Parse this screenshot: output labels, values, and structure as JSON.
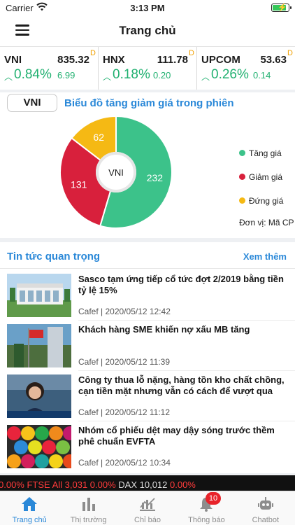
{
  "status_bar": {
    "carrier": "Carrier",
    "time": "3:13 PM",
    "battery_level": 0.9
  },
  "header": {
    "title": "Trang chủ"
  },
  "tickers": [
    {
      "name": "VNI",
      "value": "835.32",
      "mark": "D",
      "change_pct": "0.84%",
      "change": "6.99"
    },
    {
      "name": "HNX",
      "value": "111.78",
      "mark": "D",
      "change_pct": "0.18%",
      "change": "0.20"
    },
    {
      "name": "UPCOM",
      "value": "53.63",
      "mark": "D",
      "change_pct": "0.26%",
      "change": "0.14"
    }
  ],
  "chart_section": {
    "selector": "VNI",
    "title": "Biểu đồ tăng giảm giá trong phiên",
    "center_label": "VNI",
    "unit": "Đơn vị: Mã CP"
  },
  "chart_data": {
    "type": "pie",
    "categories": [
      "Tăng giá",
      "Giảm giá",
      "Đứng giá"
    ],
    "values": [
      232,
      131,
      62
    ],
    "colors": [
      "#3cc28a",
      "#d8203c",
      "#f5b914"
    ],
    "title": "Biểu đồ tăng giảm giá trong phiên",
    "legend_placement": "right"
  },
  "news": {
    "section_title": "Tin tức quan trọng",
    "more_label": "Xem thêm",
    "items": [
      {
        "headline": "Sasco tạm ứng tiếp cổ tức đợt 2/2019 bằng tiền tỷ lệ 15%",
        "source": "Cafef",
        "date": "2020/05/12 12:42"
      },
      {
        "headline": "Khách hàng SME khiến nợ xấu MB tăng",
        "source": "Cafef",
        "date": "2020/05/12 11:39"
      },
      {
        "headline": "Công ty thua lỗ nặng, hàng tồn kho chất chồng, cạn tiền mặt nhưng vẫn có cách để vượt qua",
        "source": "Cafef",
        "date": "2020/05/12 11:12"
      },
      {
        "headline": "Nhóm cổ phiếu dệt may dậy sóng trước thềm phê chuẩn EVFTA",
        "source": "Cafef",
        "date": "2020/05/12 10:34"
      }
    ]
  },
  "marquee": {
    "text_a": "0.00%   FTSE All 3,031  ",
    "text_b": "0.00%",
    "text_c": "   DAX 10,012  ",
    "text_d": "0.00%"
  },
  "tab_bar": {
    "tabs": [
      {
        "label": "Trang chủ",
        "icon": "home-icon"
      },
      {
        "label": "Thị trường",
        "icon": "bar-chart-icon"
      },
      {
        "label": "Chỉ báo",
        "icon": "indicator-icon"
      },
      {
        "label": "Thông báo",
        "icon": "bell-icon"
      },
      {
        "label": "Chatbot",
        "icon": "robot-icon"
      }
    ],
    "notification_count": "10"
  }
}
